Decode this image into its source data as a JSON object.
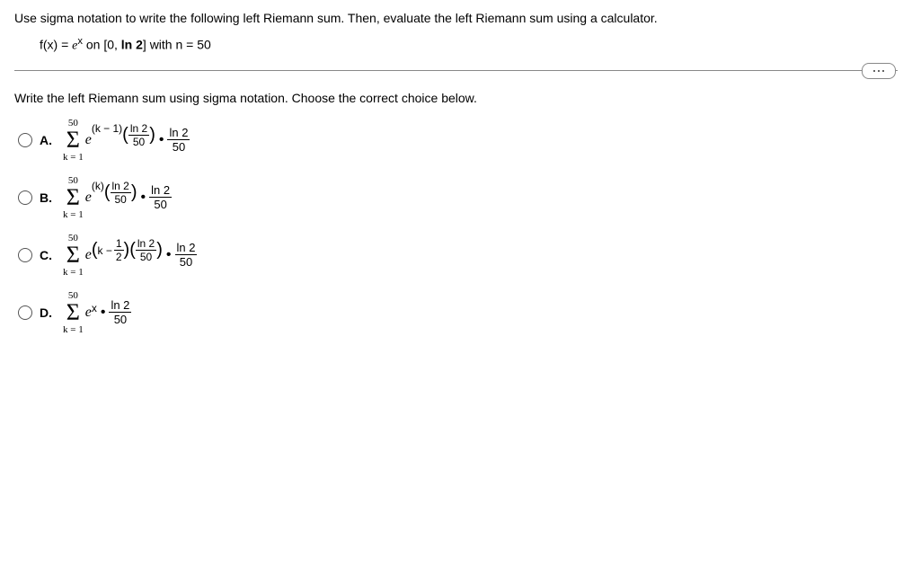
{
  "question": "Use sigma notation to write the following left Riemann sum. Then, evaluate the left Riemann sum using a calculator.",
  "given": {
    "func_prefix": "f(x) = ",
    "func_base": "e",
    "func_exp": "x",
    "func_suffix": " on [0, ",
    "ln2": "ln 2",
    "bracket_close": "] with n = 50"
  },
  "subheading": "Write the left Riemann sum using sigma notation. Choose the correct choice below.",
  "sigma": {
    "top": "50",
    "bot": "k = 1",
    "sym": "Σ"
  },
  "options": {
    "A": {
      "label": "A.",
      "exp_pre": "(k − 1)",
      "inner_num": "ln 2",
      "inner_den": "50",
      "factor_num": "ln 2",
      "factor_den": "50"
    },
    "B": {
      "label": "B.",
      "exp_pre": "(k)",
      "inner_num": "ln 2",
      "inner_den": "50",
      "factor_num": "ln 2",
      "factor_den": "50"
    },
    "C": {
      "label": "C.",
      "paren_k": "k −",
      "half_num": "1",
      "half_den": "2",
      "inner_num": "ln 2",
      "inner_den": "50",
      "factor_num": "ln 2",
      "factor_den": "50"
    },
    "D": {
      "label": "D.",
      "exp_sup": "x",
      "factor_num": "ln 2",
      "factor_den": "50"
    }
  },
  "e_char": "e",
  "dot": "•"
}
